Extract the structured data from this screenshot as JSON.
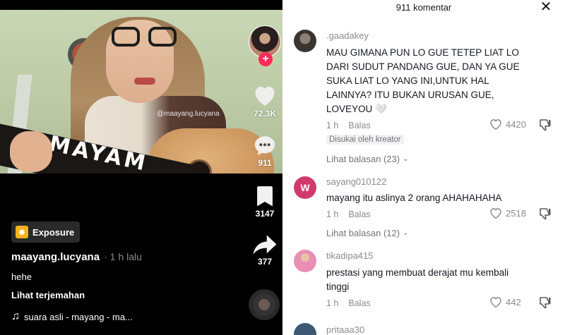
{
  "video": {
    "watermark": "@maayang.lucyana",
    "guitar_text": "MAYAM",
    "likes": "72.3K",
    "comments": "911",
    "bookmarks": "3147",
    "shares": "377",
    "follow_symbol": "+"
  },
  "caption": {
    "badge": "Exposure",
    "username": "maayang.lucyana",
    "time": "· 1 h lalu",
    "text": "hehe",
    "translate": "Lihat terjemahan",
    "sound": "suara asli - mayang - ma..."
  },
  "comments_panel": {
    "title": "911 komentar",
    "close": "✕",
    "comments": [
      {
        "user": ".gaadakey",
        "text": "MAU GIMANA PUN LO GUE TETEP LIAT LO DARI SUDUT PANDANG GUE, DAN YA GUE SUKA LIAT LO YANG INI,UNTUK HAL LAINNYA? ITU BUKAN URUSAN GUE, LOVEYOU 🤍",
        "time": "1 h",
        "reply": "Balas",
        "likes": "4420",
        "creator_tag": "Disukai oleh kreator",
        "replies": "Lihat balasan (23)"
      },
      {
        "user": "sayang010122",
        "avatar_letter": "W",
        "text": "mayang itu aslinya 2 orang AHAHAHAHA",
        "time": "1 h",
        "reply": "Balas",
        "likes": "2518",
        "replies": "Lihat balasan (12)"
      },
      {
        "user": "tikadipa415",
        "text": "prestasi yang membuat derajat mu kembali tinggi",
        "time": "1 h",
        "reply": "Balas",
        "likes": "442"
      },
      {
        "user": "pritaaa30"
      }
    ]
  },
  "colors": {
    "accent": "#fe2c55",
    "badge_icon": "#f4b41a",
    "comment_w_avatar": "#d13a6a"
  },
  "icons": [
    "heart-icon",
    "comment-icon",
    "bookmark-icon",
    "share-icon",
    "music-note-icon",
    "close-icon",
    "dislike-icon",
    "chevron-down-icon"
  ]
}
